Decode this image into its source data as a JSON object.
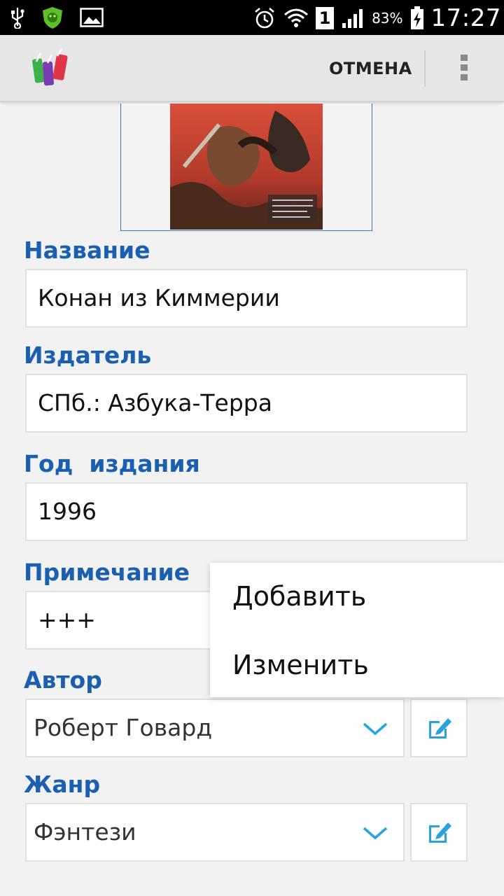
{
  "status_bar": {
    "icons_left": [
      "usb-icon",
      "security-shield-icon",
      "gallery-icon"
    ],
    "icons_right": [
      "alarm-icon",
      "wifi-icon",
      "sim-1-icon",
      "signal-icon"
    ],
    "sim_slot": "1",
    "battery_percent": "83%",
    "time": "17:27"
  },
  "action_bar": {
    "logo_icon": "books-logo-icon",
    "cancel_label": "ОТМЕНА",
    "overflow_icon": "overflow-menu-icon"
  },
  "cover": {
    "image_icon": "book-cover-image"
  },
  "form": {
    "title": {
      "label": "Название",
      "value": "Конан из Киммерии"
    },
    "publisher": {
      "label": "Издатель",
      "value": "СПб.: Азбука-Терра"
    },
    "year": {
      "label": "Год  издания",
      "value": "1996"
    },
    "note": {
      "label": "Примечание",
      "value": "+++"
    },
    "author": {
      "label": "Автор",
      "value": "Роберт Говард"
    },
    "genre": {
      "label": "Жанр",
      "value": "Фэнтези"
    }
  },
  "popup_menu": {
    "items": [
      "Добавить",
      "Изменить"
    ]
  },
  "colors": {
    "label_blue": "#1a5fb0",
    "chevron_blue": "#29a3e0",
    "edit_icon_blue": "#29a3e0"
  }
}
